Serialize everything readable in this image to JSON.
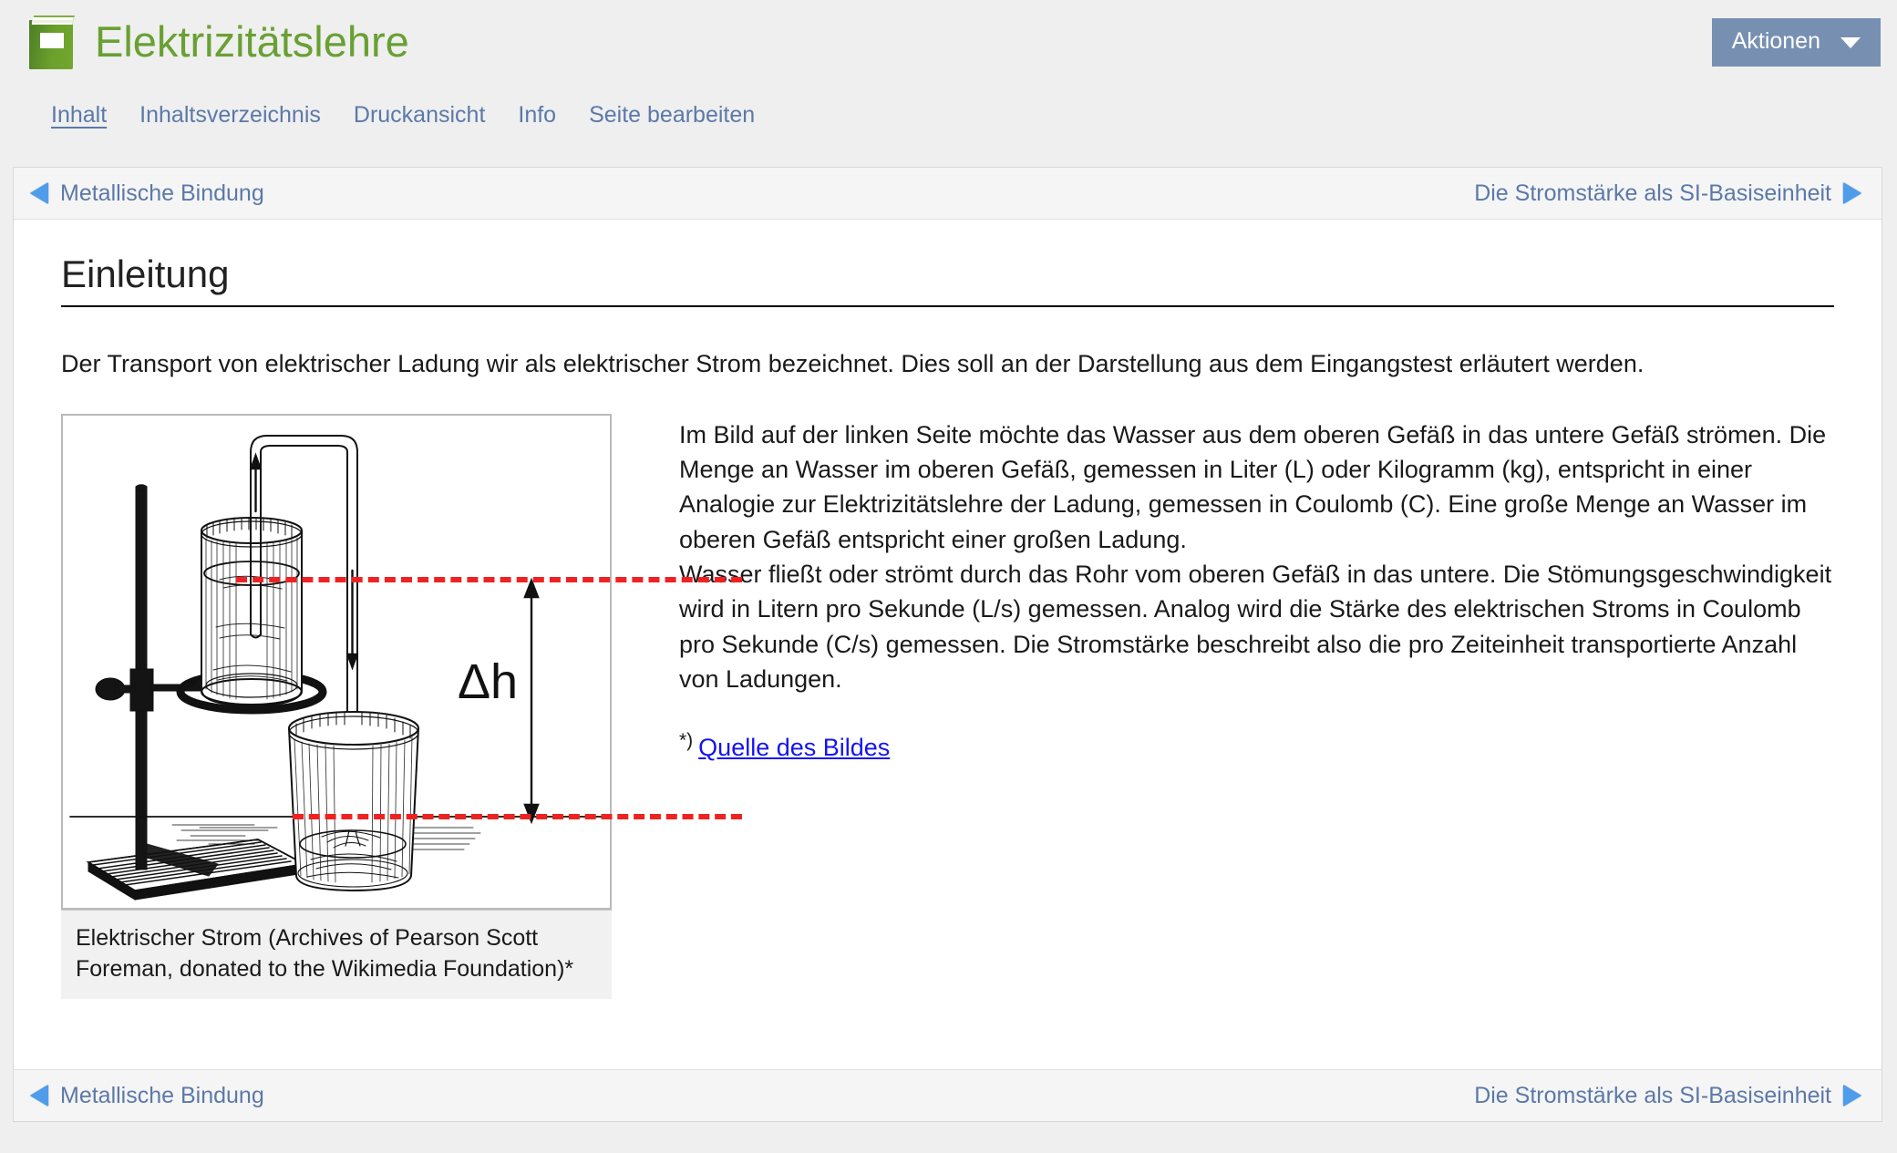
{
  "header": {
    "site_title": "Elektrizitätslehre",
    "book_icon": "book-icon",
    "actions_button": "Aktionen",
    "caret_icon": "chevron-down-icon"
  },
  "tabs": [
    {
      "label": "Inhalt",
      "active": true
    },
    {
      "label": "Inhaltsverzeichnis",
      "active": false
    },
    {
      "label": "Druckansicht",
      "active": false
    },
    {
      "label": "Info",
      "active": false
    },
    {
      "label": "Seite bearbeiten",
      "active": false
    }
  ],
  "pager": {
    "prev_label": "Metallische Bindung",
    "next_label": "Die Stromstärke als SI-Basiseinheit",
    "prev_icon": "triangle-left-icon",
    "next_icon": "triangle-right-icon"
  },
  "main": {
    "section_title": "Einleitung",
    "intro": "Der Transport von elektrischer Ladung wir als elektrischer Strom bezeichnet. Dies soll an der Darstellung aus dem Eingangstest erläutert werden.",
    "paragraph_1": "Im Bild auf der linken Seite möchte das Wasser aus dem oberen Gefäß in das untere Gefäß strömen. Die Menge an Wasser im oberen Gefäß, gemessen in Liter (L) oder Kilogramm (kg), entspricht in einer Analogie zur Elektrizitätslehre der Ladung, gemessen in Coulomb (C). Eine große Menge an Wasser im oberen Gefäß entspricht einer großen Ladung.",
    "paragraph_2": "Wasser fließt oder strömt durch das Rohr vom oberen Gefäß in das untere. Die Stömungsgeschwindigkeit wird in Litern pro Sekunde (L/s) gemessen. Analog wird die Stärke des elektrischen Stroms in Coulomb pro Sekunde (C/s) gemessen. Die Stromstärke beschreibt also die pro Zeiteinheit transportierte Anzahl von Ladungen.",
    "footnote_marker": "*)",
    "source_link_label": "Quelle des Bildes"
  },
  "figure": {
    "caption": "Elektrischer Strom (Archives of Pearson Scott Foreman, donated to the Wikimedia Foundation)*",
    "delta_h_label": "Δh",
    "alt": "siphon-experiment-illustration"
  },
  "colors": {
    "brand_green": "#69a033",
    "link_blue": "#5b79a8",
    "action_button_bg": "#7790b2",
    "arrow_blue": "#4f9ceb",
    "dash_red": "#ee2222",
    "source_link": "#1414ef",
    "page_bg": "#efefef"
  }
}
